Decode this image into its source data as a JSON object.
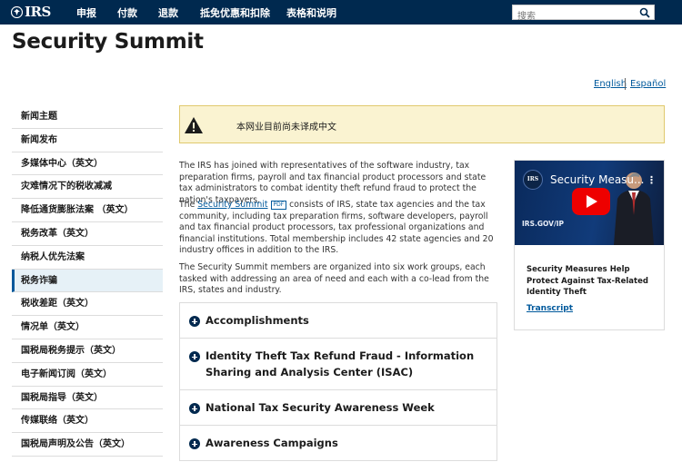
{
  "header": {
    "logo_text": "IRS",
    "nav": [
      "申报",
      "付款",
      "退款",
      "抵免优惠和扣除",
      "表格和说明"
    ],
    "search_placeholder": "搜索"
  },
  "page_title": "Security Summit",
  "languages": {
    "english": "English",
    "spanish": "Español"
  },
  "sidebar": {
    "items": [
      "新闻主题",
      "新闻发布",
      "多媒体中心（英文）",
      "灾难情况下的税收减减",
      "降低通货膨胀法案 （英文）",
      "税务改革（英文）",
      "纳税人优先法案",
      "税务诈骗",
      "税收差距（英文）",
      "情况单（英文）",
      "国税局税务提示（英文）",
      "电子新闻订阅（英文）",
      "国税局指导（英文）",
      "传媒联络（英文）",
      "国税局声明及公告（英文）"
    ],
    "active_index": 7
  },
  "alert": {
    "text": "本网业目前尚未译成中文",
    "icon": "warning-icon"
  },
  "main": {
    "p1": "The IRS has joined with representatives of the software industry, tax preparation firms, payroll and tax financial product processors and state tax administrators to combat identity theft refund fraud to protect the nation's taxpayers.",
    "p2_prefix": "The ",
    "p2_link": "Security Summit",
    "p2_badge": "PDF",
    "p2_rest": " consists of IRS, state tax agencies and the tax community, including tax preparation firms, software developers, payroll and tax financial product processors, tax professional organizations and financial institutions. Total membership includes 42 state agencies and 20 industry offices in addition to the IRS.",
    "p3": "The Security Summit members are organized into six work groups, each tasked with addressing an area of need and each with a co-lead from the IRS, states and industry."
  },
  "accordion": [
    "Accomplishments",
    "Identity Theft Tax Refund Fraud - Information Sharing and Analysis Center (ISAC)",
    "National Tax Security Awareness Week",
    "Awareness Campaigns"
  ],
  "video": {
    "thumb_title": "Security Measu...",
    "thumb_logo": "IRS",
    "thumb_url": "IRS.GOV/IP",
    "thumb_menu": "⋮",
    "caption": "Security Measures Help Protect Against Tax-Related Identity Theft",
    "transcript": "Transcript"
  },
  "colors": {
    "nav_bg": "#00294f",
    "link": "#00599c",
    "alert_bg": "#faf3d1"
  }
}
